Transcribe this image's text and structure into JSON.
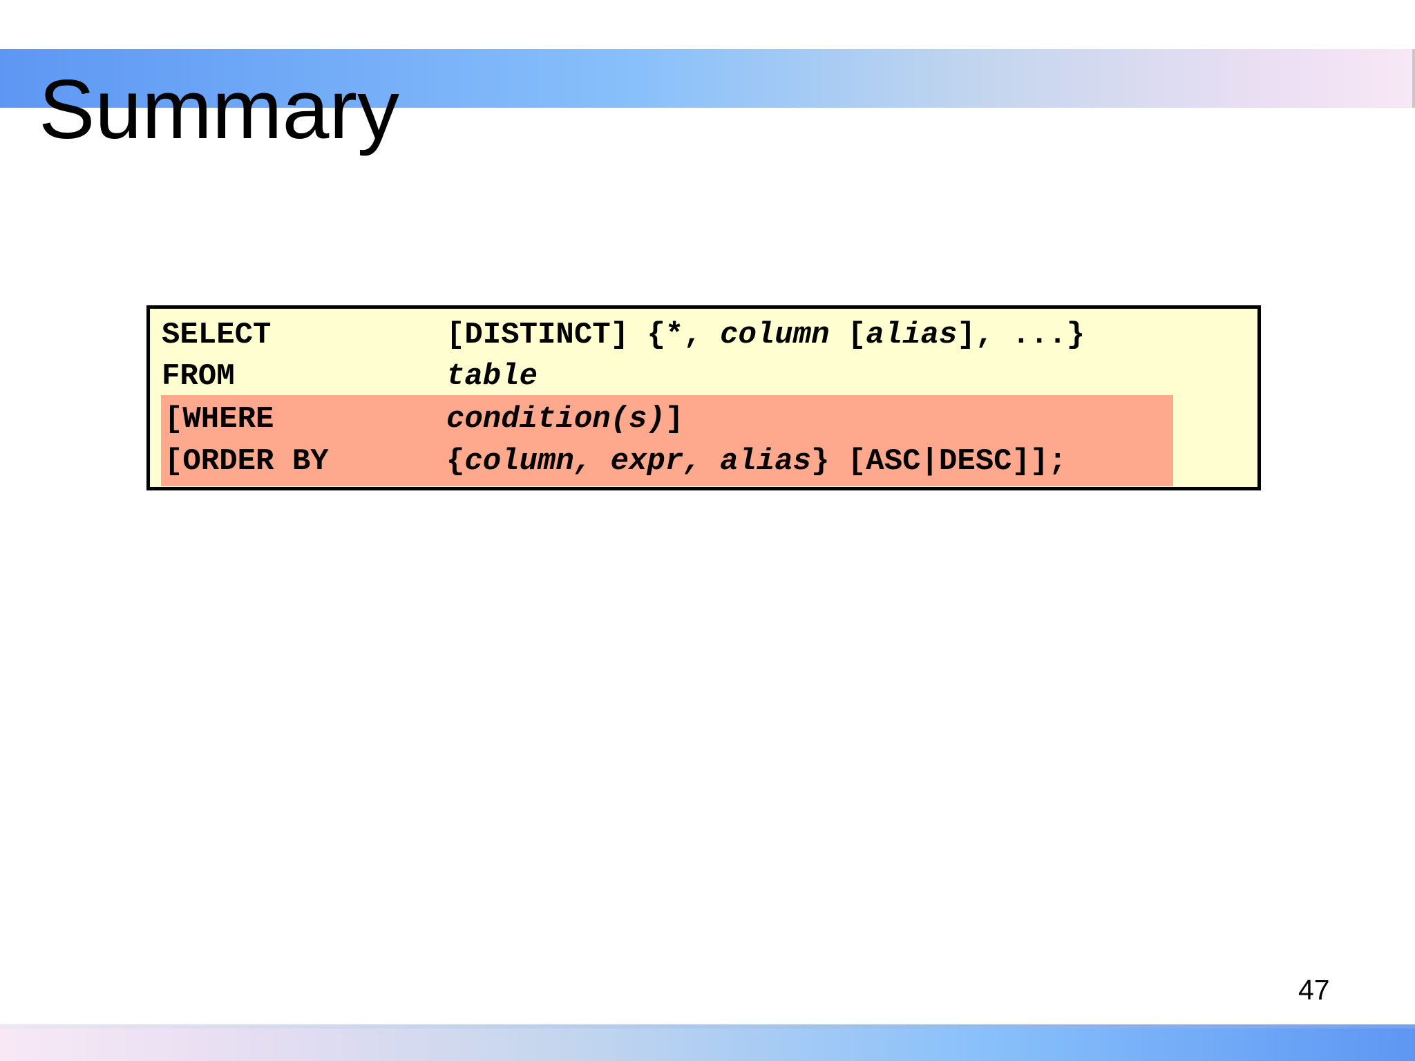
{
  "slide": {
    "title": "Summary",
    "page_number": "47"
  },
  "code": {
    "lines": [
      {
        "keyword": "SELECT",
        "parts": [
          {
            "text": "[DISTINCT] {*, ",
            "italic": false
          },
          {
            "text": "column",
            "italic": true
          },
          {
            "text": " [",
            "italic": false
          },
          {
            "text": "alias",
            "italic": true
          },
          {
            "text": "], ...}",
            "italic": false
          }
        ]
      },
      {
        "keyword": "FROM",
        "parts": [
          {
            "text": "table",
            "italic": true
          }
        ]
      },
      {
        "keyword": "[WHERE",
        "parts": [
          {
            "text": "condition(s)",
            "italic": true
          },
          {
            "text": "]",
            "italic": false
          }
        ]
      },
      {
        "keyword": "[ORDER BY",
        "parts": [
          {
            "text": "{",
            "italic": false
          },
          {
            "text": "column, expr, alias",
            "italic": true
          },
          {
            "text": "} [ASC|DESC]];",
            "italic": false
          }
        ]
      }
    ],
    "colors": {
      "box_background": "#fffed0",
      "highlight": "#fea88e",
      "border": "#000000"
    }
  },
  "theme": {
    "band_start": "#5d97f3",
    "band_end": "#f8e8f6"
  }
}
